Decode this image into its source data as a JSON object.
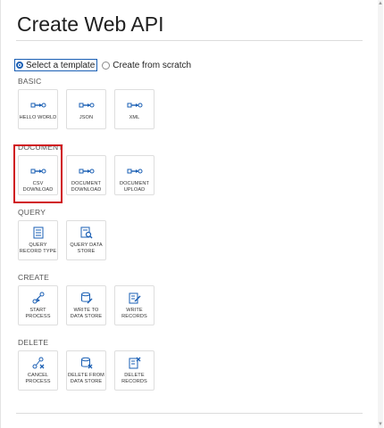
{
  "title": "Create Web API",
  "mode": {
    "option_template": "Select a template",
    "option_scratch": "Create from scratch"
  },
  "sections": {
    "basic": {
      "label": "BASIC",
      "tiles": [
        "HELLO WORLD",
        "JSON",
        "XML"
      ]
    },
    "document": {
      "label": "DOCUMENT",
      "tiles": [
        "CSV\nDOWNLOAD",
        "DOCUMENT\nDOWNLOAD",
        "DOCUMENT\nUPLOAD"
      ]
    },
    "query": {
      "label": "QUERY",
      "tiles": [
        "QUERY\nRECORD TYPE",
        "QUERY DATA\nSTORE"
      ]
    },
    "create": {
      "label": "CREATE",
      "tiles": [
        "START\nPROCESS",
        "WRITE TO\nDATA STORE",
        "WRITE\nRECORDS"
      ]
    },
    "delete": {
      "label": "DELETE",
      "tiles": [
        "CANCEL\nPROCESS",
        "DELETE FROM\nDATA STORE",
        "DELETE\nRECORDS"
      ]
    }
  },
  "colors": {
    "accent": "#1a5fb4",
    "highlight": "#d0121b"
  }
}
